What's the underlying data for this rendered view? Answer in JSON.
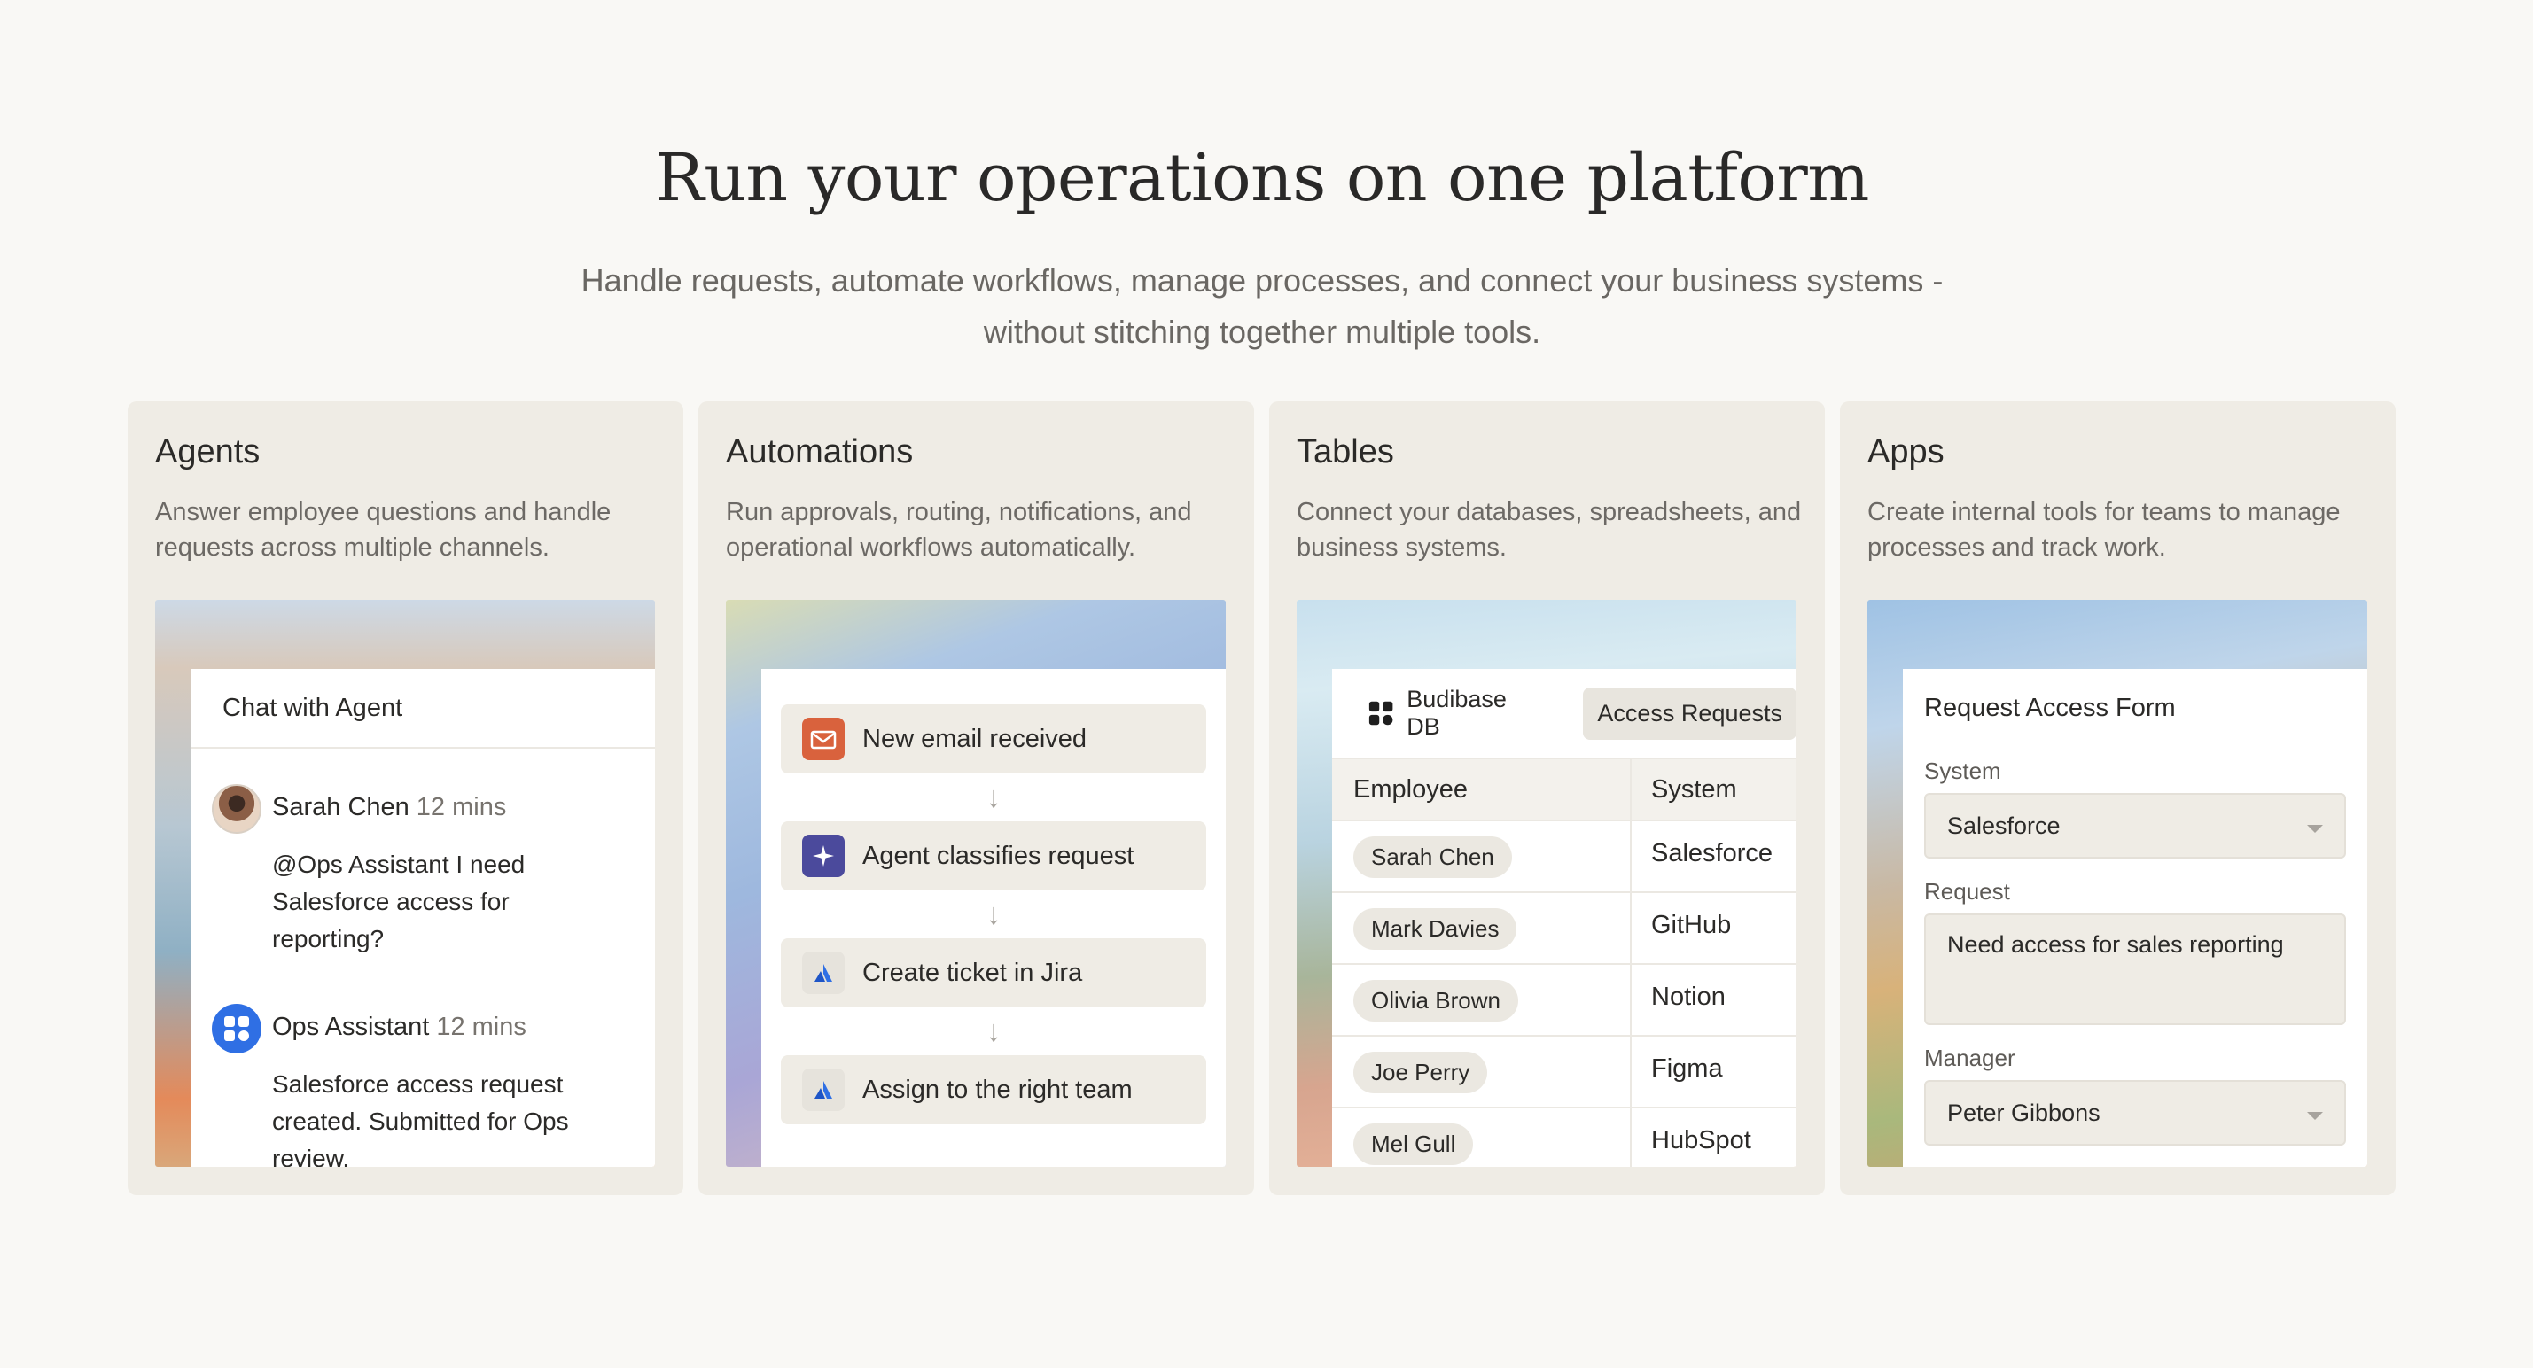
{
  "hero": {
    "title": "Run your operations on one platform",
    "subtitle": "Handle requests, automate workflows, manage processes, and connect your business systems - without stitching together multiple tools."
  },
  "cards": {
    "agents": {
      "title": "Agents",
      "description": "Answer employee questions and handle requests across multiple channels.",
      "chat_header": "Chat with Agent",
      "messages": [
        {
          "name": "Sarah Chen",
          "time": "12 mins",
          "text": "@Ops Assistant I need Salesforce access for reporting?"
        },
        {
          "name": "Ops Assistant",
          "time": "12 mins",
          "text": "Salesforce access request created. Submitted for Ops review."
        }
      ]
    },
    "automations": {
      "title": "Automations",
      "description": "Run approvals, routing, notifications, and operational workflows automatically.",
      "steps": [
        {
          "label": "New email received",
          "icon": "envelope-icon"
        },
        {
          "label": "Agent classifies request",
          "icon": "sparkle-icon"
        },
        {
          "label": "Create ticket in Jira",
          "icon": "jira-icon"
        },
        {
          "label": "Assign to the right team",
          "icon": "jira-icon"
        }
      ]
    },
    "tables": {
      "title": "Tables",
      "description": "Connect your databases, spreadsheets, and business systems.",
      "db_tab": "Budibase DB",
      "active_tab": "Access Requests",
      "columns": [
        "Employee",
        "System"
      ],
      "rows": [
        [
          "Sarah Chen",
          "Salesforce"
        ],
        [
          "Mark Davies",
          "GitHub"
        ],
        [
          "Olivia Brown",
          "Notion"
        ],
        [
          "Joe Perry",
          "Figma"
        ],
        [
          "Mel Gull",
          "HubSpot"
        ]
      ]
    },
    "apps": {
      "title": "Apps",
      "description": "Create internal tools for teams to manage processes and track work.",
      "form_title": "Request Access Form",
      "system_label": "System",
      "system_value": "Salesforce",
      "request_label": "Request",
      "request_value": "Need access for sales reporting",
      "manager_label": "Manager",
      "manager_value": "Peter Gibbons"
    }
  },
  "colors": {
    "page_bg": "#f9f8f5",
    "card_bg": "#efece5",
    "ops_avatar": "#2f6fe4",
    "email_icon": "#d9623d",
    "sparkle_icon": "#4b4a9c",
    "jira_icon": "#2f6fe4"
  }
}
